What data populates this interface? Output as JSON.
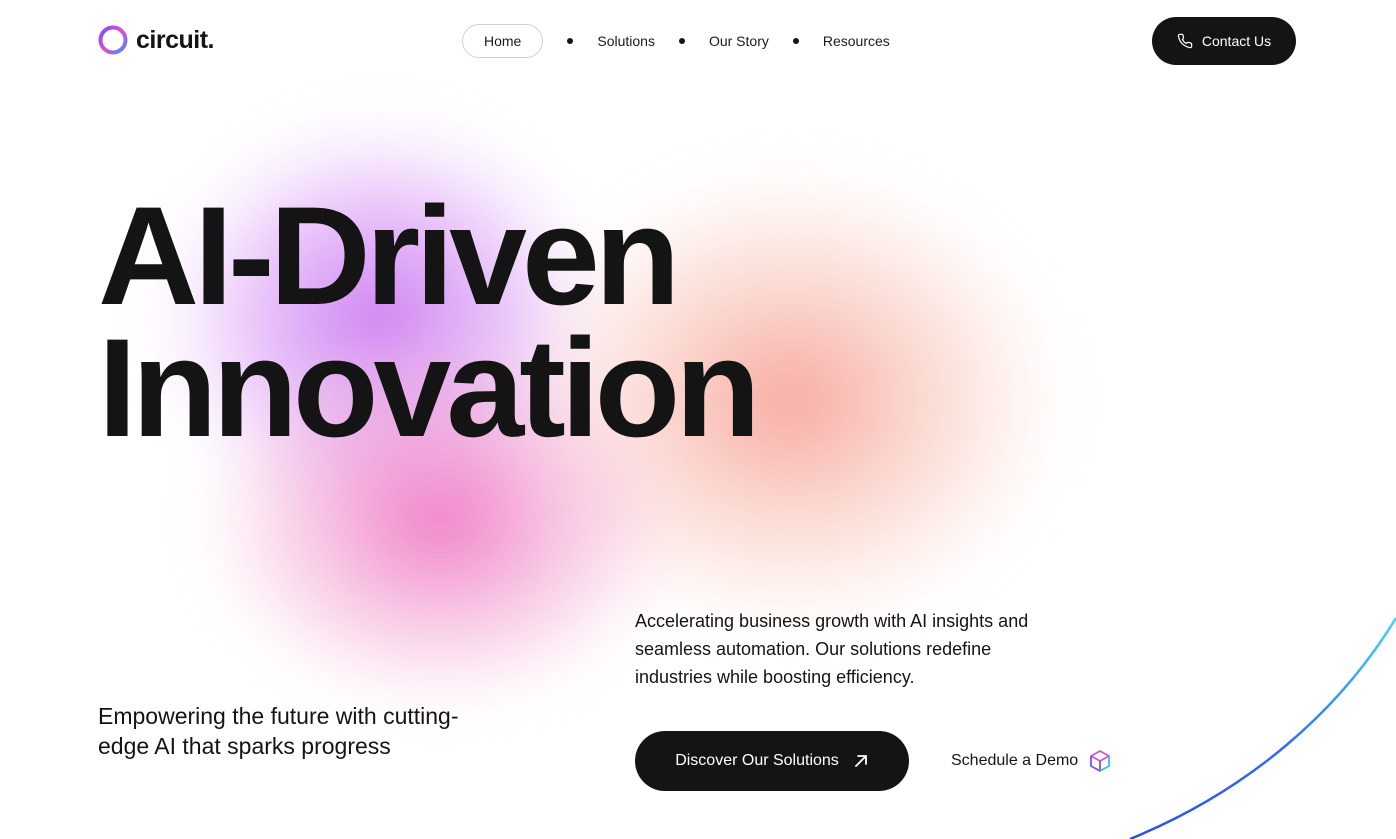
{
  "brand": {
    "name": "circuit.",
    "logo_icon": "ring-logo-icon"
  },
  "nav": {
    "items": [
      {
        "label": "Home",
        "active": true
      },
      {
        "label": "Solutions",
        "active": false
      },
      {
        "label": "Our Story",
        "active": false
      },
      {
        "label": "Resources",
        "active": false
      }
    ]
  },
  "header": {
    "contact_label": "Contact Us",
    "contact_icon": "phone-icon"
  },
  "hero": {
    "title_line1": "AI-Driven",
    "title_line2": "Innovation",
    "tagline": "Empowering the future with cutting-edge AI that sparks progress",
    "description": "Accelerating business growth with AI insights and seamless automation. Our solutions redefine industries while boosting efficiency.",
    "primary_cta": "Discover Our Solutions",
    "primary_cta_icon": "arrow-up-right-icon",
    "secondary_cta": "Schedule a Demo",
    "secondary_cta_icon": "cube-icon"
  },
  "colors": {
    "text": "#141414",
    "button_bg": "#141414",
    "button_text": "#ffffff",
    "accent_purple": "#c76ef0",
    "accent_pink": "#ee6ebe",
    "accent_peach": "#f5968c",
    "accent_blue": "#2f6bff",
    "accent_cyan": "#3fd6f0"
  }
}
